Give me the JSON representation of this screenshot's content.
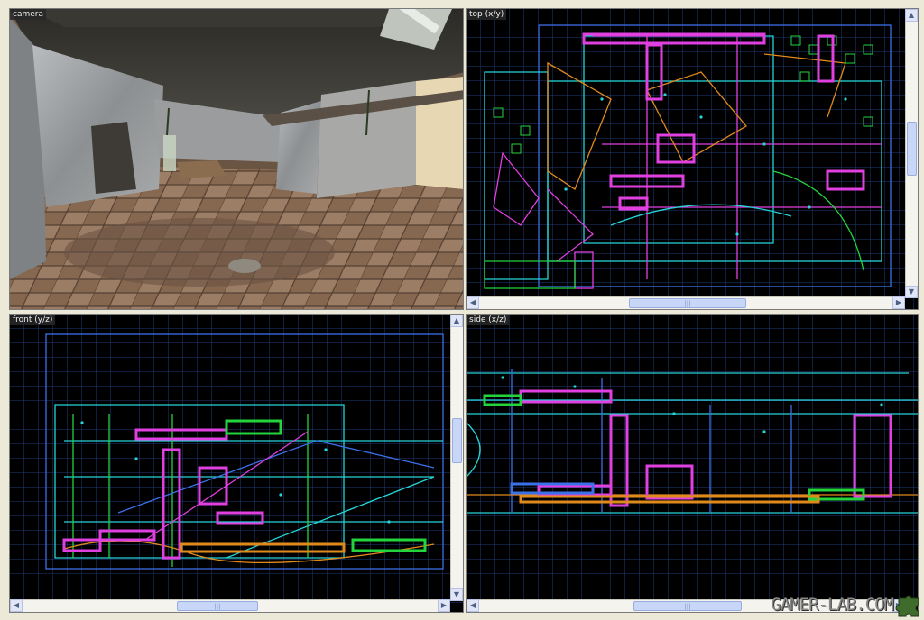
{
  "viewports": {
    "camera": {
      "label": "camera"
    },
    "top": {
      "label": "top (x/y)"
    },
    "front": {
      "label": "front (y/z)"
    },
    "side": {
      "label": "side (x/z)"
    }
  },
  "scroll": {
    "up_arrow": "▲",
    "down_arrow": "▼",
    "left_arrow": "◀",
    "right_arrow": "▶",
    "grip": "|||"
  },
  "colors": {
    "grid": "#1f3a78",
    "grid_major": "#2f5aa8",
    "brush_cyan": "#27d4d8",
    "brush_magenta": "#e040e0",
    "brush_green": "#24d43c",
    "brush_orange": "#e08a1c",
    "brush_blue": "#3a70e8"
  },
  "watermark": {
    "text": "GAMER-LAB.COM"
  }
}
